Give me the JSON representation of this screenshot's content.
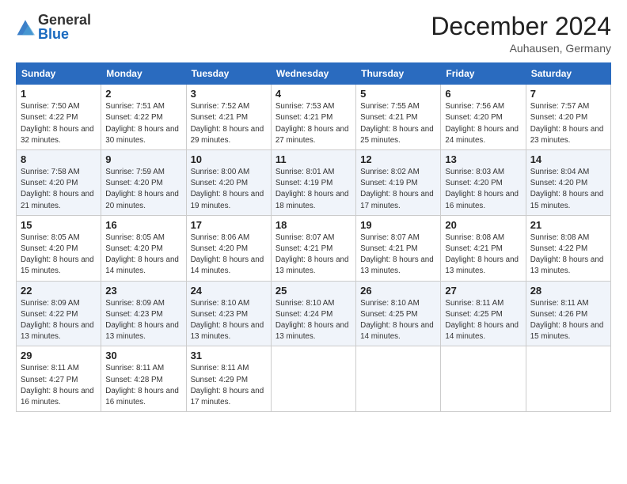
{
  "logo": {
    "general": "General",
    "blue": "Blue"
  },
  "header": {
    "month_title": "December 2024",
    "location": "Auhausen, Germany"
  },
  "weekdays": [
    "Sunday",
    "Monday",
    "Tuesday",
    "Wednesday",
    "Thursday",
    "Friday",
    "Saturday"
  ],
  "weeks": [
    [
      {
        "day": "1",
        "sunrise": "Sunrise: 7:50 AM",
        "sunset": "Sunset: 4:22 PM",
        "daylight": "Daylight: 8 hours and 32 minutes."
      },
      {
        "day": "2",
        "sunrise": "Sunrise: 7:51 AM",
        "sunset": "Sunset: 4:22 PM",
        "daylight": "Daylight: 8 hours and 30 minutes."
      },
      {
        "day": "3",
        "sunrise": "Sunrise: 7:52 AM",
        "sunset": "Sunset: 4:21 PM",
        "daylight": "Daylight: 8 hours and 29 minutes."
      },
      {
        "day": "4",
        "sunrise": "Sunrise: 7:53 AM",
        "sunset": "Sunset: 4:21 PM",
        "daylight": "Daylight: 8 hours and 27 minutes."
      },
      {
        "day": "5",
        "sunrise": "Sunrise: 7:55 AM",
        "sunset": "Sunset: 4:21 PM",
        "daylight": "Daylight: 8 hours and 25 minutes."
      },
      {
        "day": "6",
        "sunrise": "Sunrise: 7:56 AM",
        "sunset": "Sunset: 4:20 PM",
        "daylight": "Daylight: 8 hours and 24 minutes."
      },
      {
        "day": "7",
        "sunrise": "Sunrise: 7:57 AM",
        "sunset": "Sunset: 4:20 PM",
        "daylight": "Daylight: 8 hours and 23 minutes."
      }
    ],
    [
      {
        "day": "8",
        "sunrise": "Sunrise: 7:58 AM",
        "sunset": "Sunset: 4:20 PM",
        "daylight": "Daylight: 8 hours and 21 minutes."
      },
      {
        "day": "9",
        "sunrise": "Sunrise: 7:59 AM",
        "sunset": "Sunset: 4:20 PM",
        "daylight": "Daylight: 8 hours and 20 minutes."
      },
      {
        "day": "10",
        "sunrise": "Sunrise: 8:00 AM",
        "sunset": "Sunset: 4:20 PM",
        "daylight": "Daylight: 8 hours and 19 minutes."
      },
      {
        "day": "11",
        "sunrise": "Sunrise: 8:01 AM",
        "sunset": "Sunset: 4:19 PM",
        "daylight": "Daylight: 8 hours and 18 minutes."
      },
      {
        "day": "12",
        "sunrise": "Sunrise: 8:02 AM",
        "sunset": "Sunset: 4:19 PM",
        "daylight": "Daylight: 8 hours and 17 minutes."
      },
      {
        "day": "13",
        "sunrise": "Sunrise: 8:03 AM",
        "sunset": "Sunset: 4:20 PM",
        "daylight": "Daylight: 8 hours and 16 minutes."
      },
      {
        "day": "14",
        "sunrise": "Sunrise: 8:04 AM",
        "sunset": "Sunset: 4:20 PM",
        "daylight": "Daylight: 8 hours and 15 minutes."
      }
    ],
    [
      {
        "day": "15",
        "sunrise": "Sunrise: 8:05 AM",
        "sunset": "Sunset: 4:20 PM",
        "daylight": "Daylight: 8 hours and 15 minutes."
      },
      {
        "day": "16",
        "sunrise": "Sunrise: 8:05 AM",
        "sunset": "Sunset: 4:20 PM",
        "daylight": "Daylight: 8 hours and 14 minutes."
      },
      {
        "day": "17",
        "sunrise": "Sunrise: 8:06 AM",
        "sunset": "Sunset: 4:20 PM",
        "daylight": "Daylight: 8 hours and 14 minutes."
      },
      {
        "day": "18",
        "sunrise": "Sunrise: 8:07 AM",
        "sunset": "Sunset: 4:21 PM",
        "daylight": "Daylight: 8 hours and 13 minutes."
      },
      {
        "day": "19",
        "sunrise": "Sunrise: 8:07 AM",
        "sunset": "Sunset: 4:21 PM",
        "daylight": "Daylight: 8 hours and 13 minutes."
      },
      {
        "day": "20",
        "sunrise": "Sunrise: 8:08 AM",
        "sunset": "Sunset: 4:21 PM",
        "daylight": "Daylight: 8 hours and 13 minutes."
      },
      {
        "day": "21",
        "sunrise": "Sunrise: 8:08 AM",
        "sunset": "Sunset: 4:22 PM",
        "daylight": "Daylight: 8 hours and 13 minutes."
      }
    ],
    [
      {
        "day": "22",
        "sunrise": "Sunrise: 8:09 AM",
        "sunset": "Sunset: 4:22 PM",
        "daylight": "Daylight: 8 hours and 13 minutes."
      },
      {
        "day": "23",
        "sunrise": "Sunrise: 8:09 AM",
        "sunset": "Sunset: 4:23 PM",
        "daylight": "Daylight: 8 hours and 13 minutes."
      },
      {
        "day": "24",
        "sunrise": "Sunrise: 8:10 AM",
        "sunset": "Sunset: 4:23 PM",
        "daylight": "Daylight: 8 hours and 13 minutes."
      },
      {
        "day": "25",
        "sunrise": "Sunrise: 8:10 AM",
        "sunset": "Sunset: 4:24 PM",
        "daylight": "Daylight: 8 hours and 13 minutes."
      },
      {
        "day": "26",
        "sunrise": "Sunrise: 8:10 AM",
        "sunset": "Sunset: 4:25 PM",
        "daylight": "Daylight: 8 hours and 14 minutes."
      },
      {
        "day": "27",
        "sunrise": "Sunrise: 8:11 AM",
        "sunset": "Sunset: 4:25 PM",
        "daylight": "Daylight: 8 hours and 14 minutes."
      },
      {
        "day": "28",
        "sunrise": "Sunrise: 8:11 AM",
        "sunset": "Sunset: 4:26 PM",
        "daylight": "Daylight: 8 hours and 15 minutes."
      }
    ],
    [
      {
        "day": "29",
        "sunrise": "Sunrise: 8:11 AM",
        "sunset": "Sunset: 4:27 PM",
        "daylight": "Daylight: 8 hours and 16 minutes."
      },
      {
        "day": "30",
        "sunrise": "Sunrise: 8:11 AM",
        "sunset": "Sunset: 4:28 PM",
        "daylight": "Daylight: 8 hours and 16 minutes."
      },
      {
        "day": "31",
        "sunrise": "Sunrise: 8:11 AM",
        "sunset": "Sunset: 4:29 PM",
        "daylight": "Daylight: 8 hours and 17 minutes."
      },
      null,
      null,
      null,
      null
    ]
  ]
}
